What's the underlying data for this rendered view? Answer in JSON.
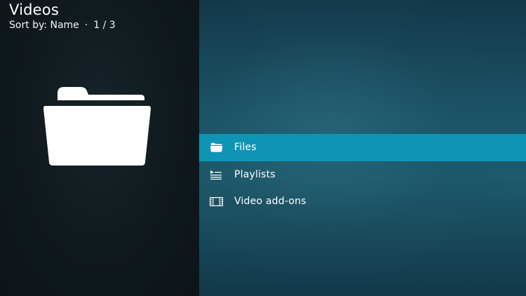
{
  "header": {
    "title": "Videos",
    "sort_label": "Sort by: Name",
    "separator": "·",
    "page_indicator": "1 / 3"
  },
  "preview": {
    "icon": "folder-icon"
  },
  "menu": {
    "items": [
      {
        "label": "Files",
        "icon": "folder-icon",
        "selected": true
      },
      {
        "label": "Playlists",
        "icon": "playlist-icon",
        "selected": false
      },
      {
        "label": "Video add-ons",
        "icon": "film-strip-icon",
        "selected": false
      }
    ]
  },
  "colors": {
    "selection": "#0e95b6",
    "left_panel": "#10191d",
    "right_panel": "#1b5567",
    "text": "#ffffff"
  }
}
